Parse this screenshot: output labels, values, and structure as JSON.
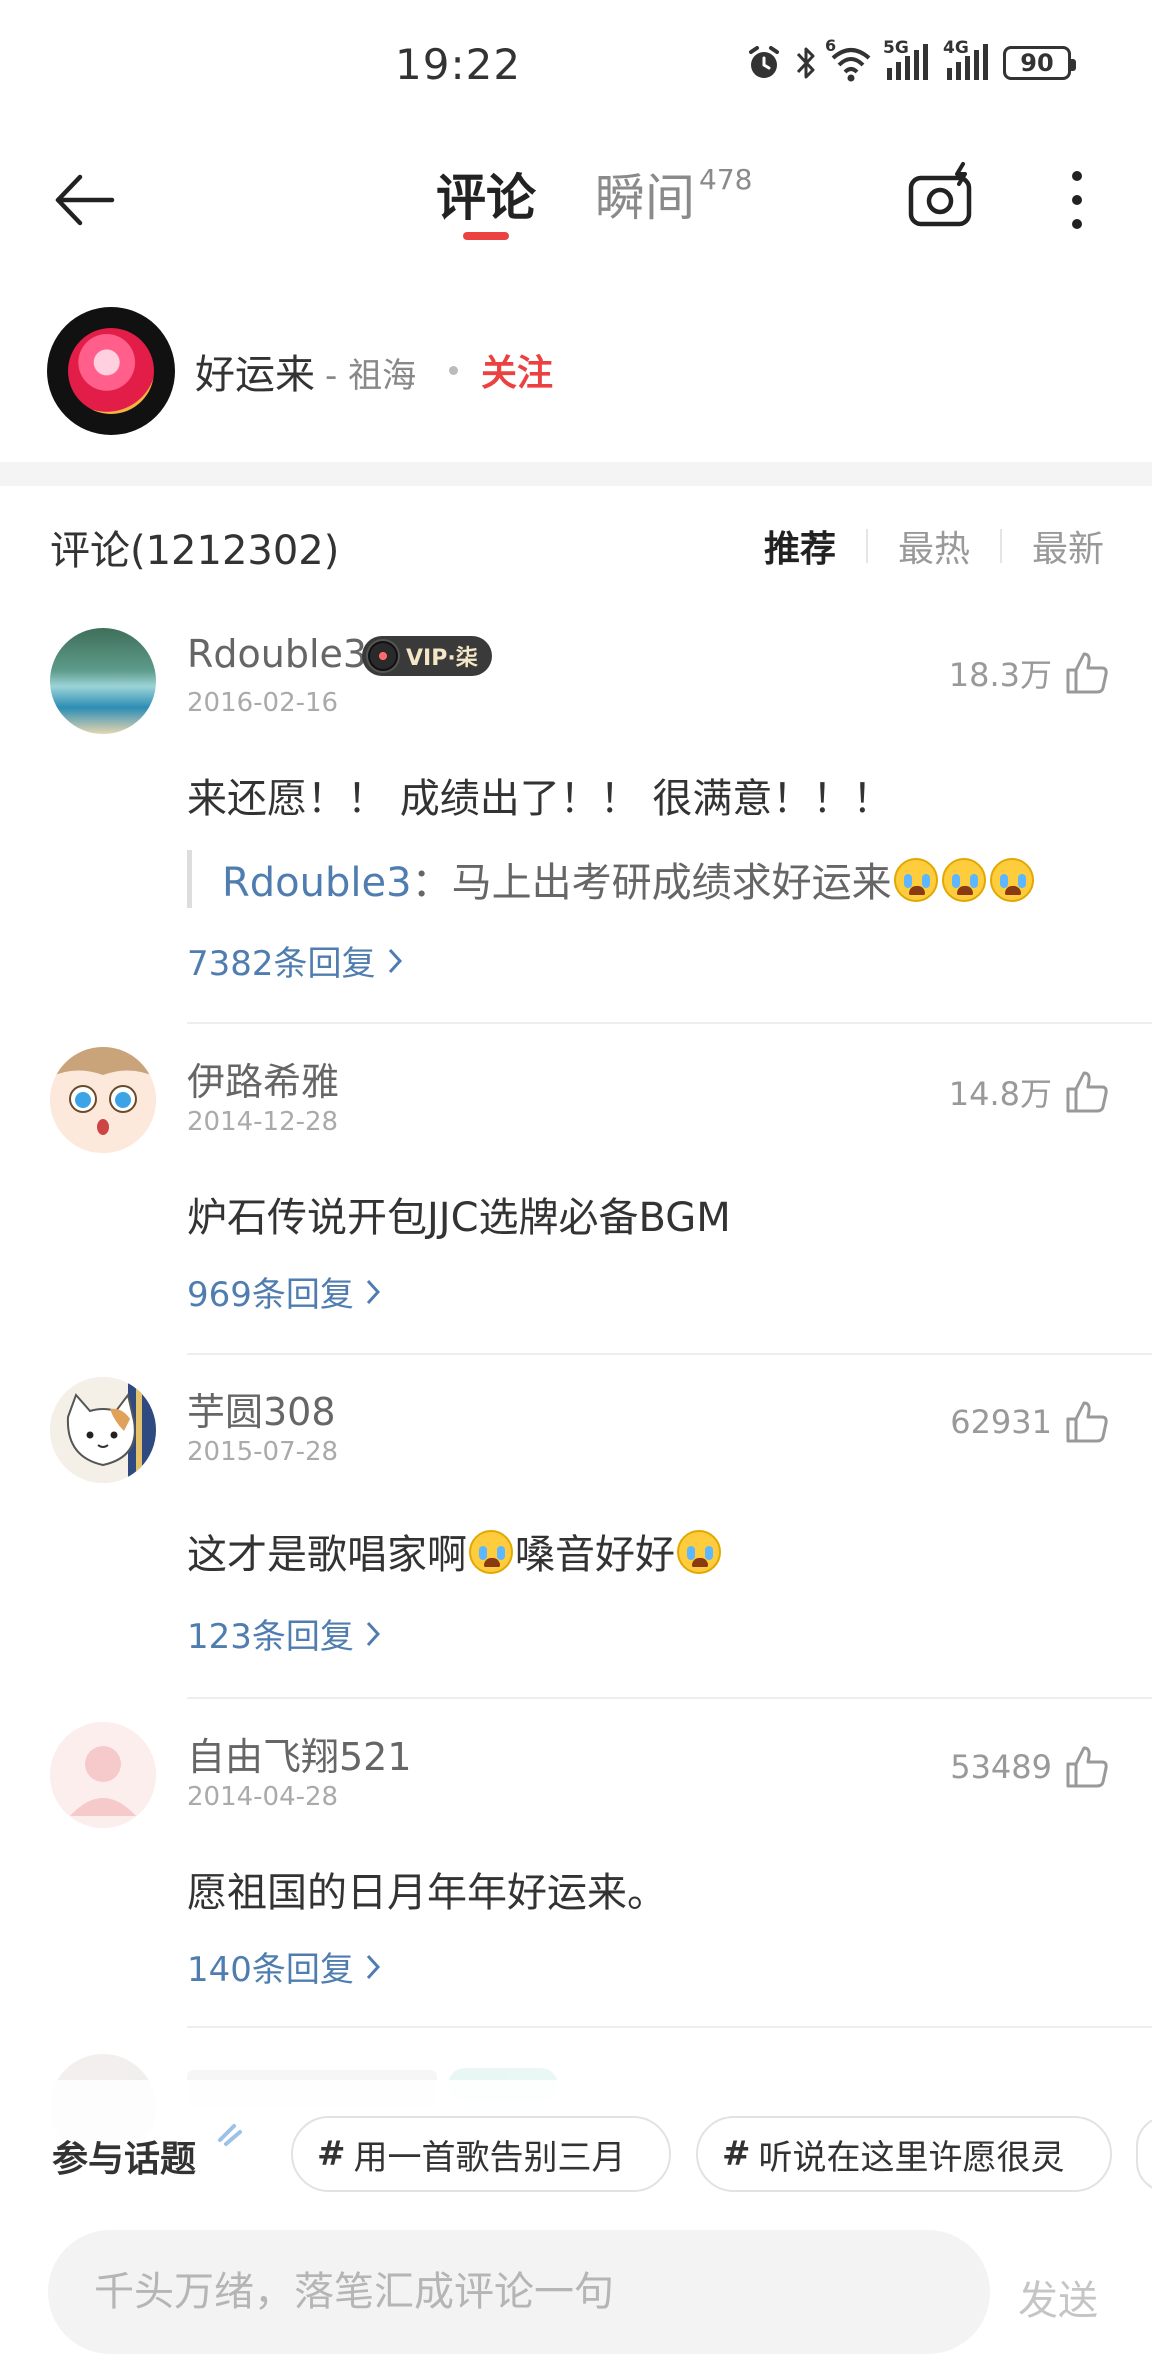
{
  "status_bar": {
    "time": "19:22",
    "network_5g": "5G",
    "network_4g": "4G",
    "wifi_superscript": "6",
    "battery": "90"
  },
  "header": {
    "tabs": [
      {
        "label": "评论",
        "active": true
      },
      {
        "label": "瞬间",
        "badge": "478",
        "active": false
      }
    ],
    "accent_color": "#ec4141"
  },
  "song": {
    "title": "好运来",
    "artist": "- 祖海",
    "follow_label": "关注"
  },
  "comments_section": {
    "title": "评论(1212302)",
    "sort_options": [
      "推荐",
      "最热",
      "最新"
    ],
    "active_sort": "推荐"
  },
  "comments": [
    {
      "user": "Rdouble3",
      "vip": "VIP·柒",
      "date": "2016-02-16",
      "likes": "18.3万",
      "text": "来还愿！！ 成绩出了！！ 很满意！！！",
      "quote_user": "Rdouble3",
      "quote_text": "：马上出考研成绩求好运来",
      "replies": "7382条回复"
    },
    {
      "user": "伊路希雅",
      "date": "2014-12-28",
      "likes": "14.8万",
      "text": "炉石传说开包JJC选牌必备BGM",
      "replies": "969条回复"
    },
    {
      "user": "芋圆308",
      "date": "2015-07-28",
      "likes": "62931",
      "text_part1": "这才是歌唱家啊",
      "text_part2": "嗓音好好",
      "replies": "123条回复"
    },
    {
      "user": "自由飞翔521",
      "date": "2014-04-28",
      "likes": "53489",
      "text": "愿祖国的日月年年好运来。",
      "replies": "140条回复"
    }
  ],
  "bottom": {
    "topic_label": "参与话题",
    "topics": [
      "用一首歌告别三月",
      "听说在这里许愿很灵"
    ],
    "input_placeholder": "千头万绪，落笔汇成评论一句",
    "send_label": "发送"
  }
}
